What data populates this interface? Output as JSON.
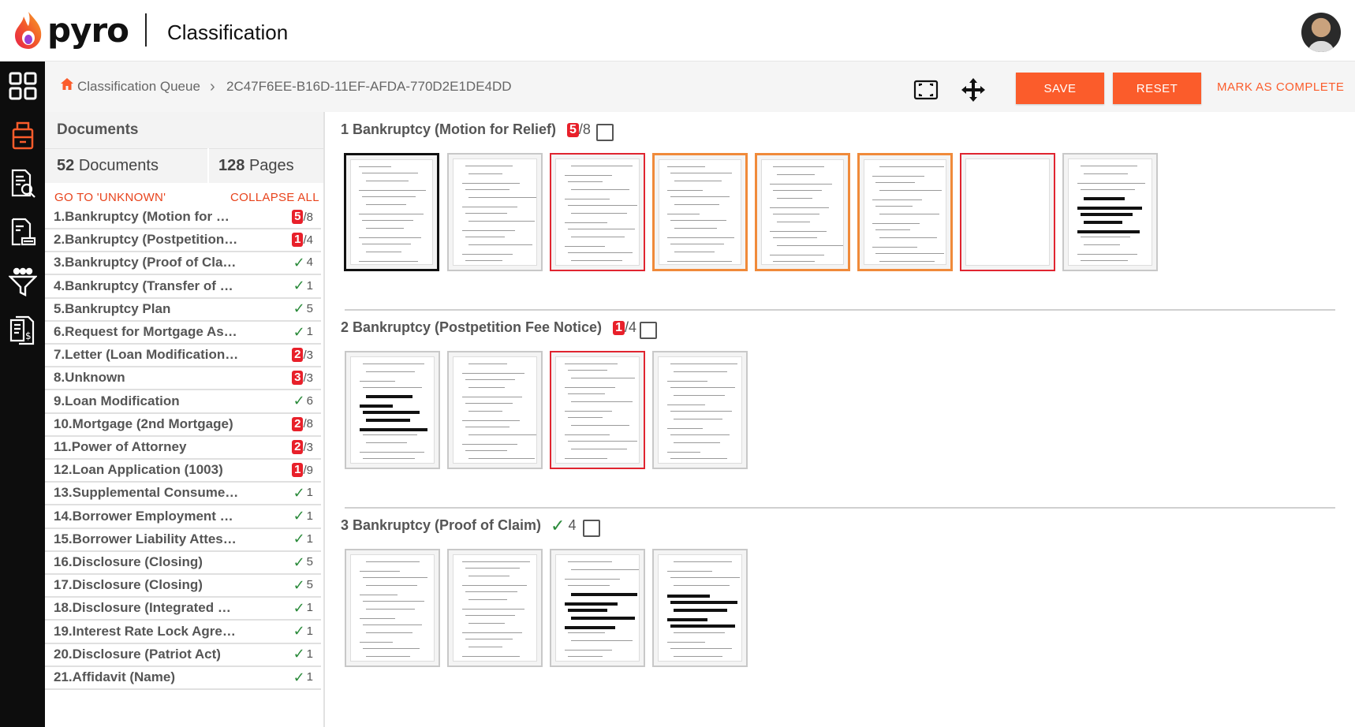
{
  "header": {
    "brand": "pyro",
    "title": "Classification"
  },
  "breadcrumb": {
    "root": "Classification Queue",
    "current": "2C47F6EE-B16D-11EF-AFDA-770D2E1DE4DD"
  },
  "toolbar": {
    "save_label": "SAVE",
    "reset_label": "RESET",
    "complete_label": "MARK AS COMPLETE"
  },
  "documents": {
    "heading": "Documents",
    "doc_count": "52",
    "doc_count_label": "Documents",
    "page_count": "128",
    "page_count_label": "Pages",
    "goto_unknown": "GO TO 'UNKNOWN'",
    "collapse_all": "COLLAPSE ALL",
    "items": [
      {
        "label": "1.Bankruptcy (Motion for …",
        "flag": "5",
        "total": "/8",
        "state": "error"
      },
      {
        "label": "2.Bankruptcy (Postpetition…",
        "flag": "1",
        "total": "/4",
        "state": "error"
      },
      {
        "label": "3.Bankruptcy (Proof of Cla…",
        "flag": "",
        "total": "4",
        "state": "ok"
      },
      {
        "label": "4.Bankruptcy (Transfer of …",
        "flag": "",
        "total": "1",
        "state": "ok"
      },
      {
        "label": "5.Bankruptcy Plan",
        "flag": "",
        "total": "5",
        "state": "ok"
      },
      {
        "label": "6.Request for Mortgage As…",
        "flag": "",
        "total": "1",
        "state": "ok"
      },
      {
        "label": "7.Letter (Loan Modification…",
        "flag": "2",
        "total": "/3",
        "state": "error"
      },
      {
        "label": "8.Unknown",
        "flag": "3",
        "total": "/3",
        "state": "error"
      },
      {
        "label": "9.Loan Modification",
        "flag": "",
        "total": "6",
        "state": "ok"
      },
      {
        "label": "10.Mortgage (2nd Mortgage)",
        "flag": "2",
        "total": "/8",
        "state": "error"
      },
      {
        "label": "11.Power of Attorney",
        "flag": "2",
        "total": "/3",
        "state": "error"
      },
      {
        "label": "12.Loan Application (1003)",
        "flag": "1",
        "total": "/9",
        "state": "error"
      },
      {
        "label": "13.Supplemental Consume…",
        "flag": "",
        "total": "1",
        "state": "ok"
      },
      {
        "label": "14.Borrower Employment …",
        "flag": "",
        "total": "1",
        "state": "ok"
      },
      {
        "label": "15.Borrower Liability Attes…",
        "flag": "",
        "total": "1",
        "state": "ok"
      },
      {
        "label": "16.Disclosure (Closing)",
        "flag": "",
        "total": "5",
        "state": "ok"
      },
      {
        "label": "17.Disclosure (Closing)",
        "flag": "",
        "total": "5",
        "state": "ok"
      },
      {
        "label": "18.Disclosure (Integrated …",
        "flag": "",
        "total": "1",
        "state": "ok"
      },
      {
        "label": "19.Interest Rate Lock Agre…",
        "flag": "",
        "total": "1",
        "state": "ok"
      },
      {
        "label": "20.Disclosure (Patriot Act)",
        "flag": "",
        "total": "1",
        "state": "ok"
      },
      {
        "label": "21.Affidavit (Name)",
        "flag": "",
        "total": "1",
        "state": "ok"
      }
    ]
  },
  "sections": [
    {
      "title": "1 Bankruptcy (Motion for Relief)",
      "flag": "5",
      "total": "/8",
      "state": "error",
      "pages": [
        "selected",
        "normal",
        "flagged",
        "warning",
        "warning",
        "warning",
        "flagged",
        "normal"
      ]
    },
    {
      "title": "2 Bankruptcy (Postpetition Fee Notice)",
      "flag": "1",
      "total": "/4",
      "state": "error",
      "pages": [
        "normal",
        "normal",
        "flagged",
        "normal"
      ]
    },
    {
      "title": "3 Bankruptcy (Proof of Claim)",
      "flag": "",
      "total": "4",
      "state": "ok",
      "pages": [
        "normal",
        "normal",
        "normal",
        "normal"
      ]
    }
  ],
  "colors": {
    "accent": "#fb5c2b",
    "error": "#e8202a",
    "ok": "#2a8a3a",
    "warning": "#f08a3a"
  },
  "icons": {
    "rail": [
      "dashboard-grid-icon",
      "classification-icon",
      "document-search-icon",
      "document-extract-icon",
      "filter-icon",
      "document-money-icon"
    ],
    "toolbar": [
      "fit-screen-icon",
      "move-arrows-icon"
    ]
  }
}
